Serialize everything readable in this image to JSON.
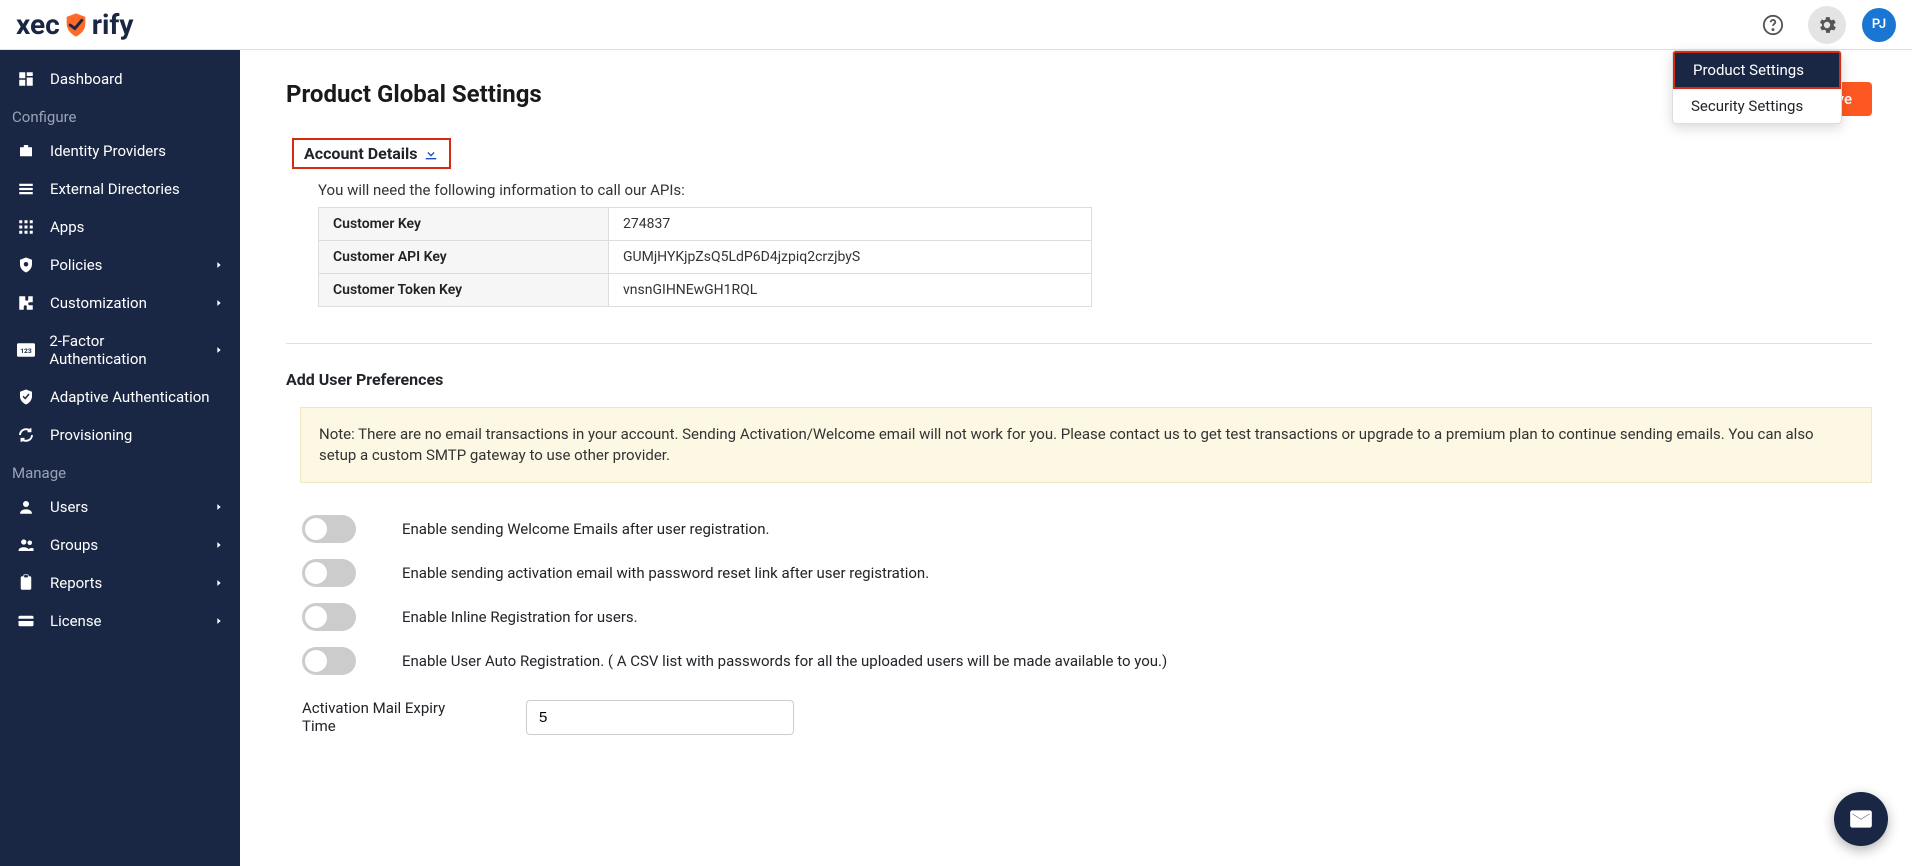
{
  "logo": {
    "prefix": "xec",
    "suffix": "rify"
  },
  "header": {
    "avatar_initials": "PJ"
  },
  "settings_menu": {
    "items": [
      {
        "label": "Product Settings",
        "active": true
      },
      {
        "label": "Security Settings",
        "active": false
      }
    ]
  },
  "sidebar": {
    "items": [
      {
        "label": "Dashboard",
        "icon": "dashboard"
      }
    ],
    "section_configure": "Configure",
    "configure_items": [
      {
        "label": "Identity Providers",
        "icon": "briefcase"
      },
      {
        "label": "External Directories",
        "icon": "list"
      },
      {
        "label": "Apps",
        "icon": "grid"
      },
      {
        "label": "Policies",
        "icon": "shield-search",
        "chevron": true
      },
      {
        "label": "Customization",
        "icon": "puzzle",
        "chevron": true
      },
      {
        "label": "2-Factor Authentication",
        "icon": "123",
        "chevron": true
      },
      {
        "label": "Adaptive Authentication",
        "icon": "shield-check"
      },
      {
        "label": "Provisioning",
        "icon": "sync"
      }
    ],
    "section_manage": "Manage",
    "manage_items": [
      {
        "label": "Users",
        "icon": "user",
        "chevron": true
      },
      {
        "label": "Groups",
        "icon": "users",
        "chevron": true
      },
      {
        "label": "Reports",
        "icon": "clipboard",
        "chevron": true
      },
      {
        "label": "License",
        "icon": "card",
        "chevron": true
      }
    ]
  },
  "page": {
    "title": "Product Global Settings",
    "save_label": "Save",
    "account_details_header": "Account Details",
    "api_info": "You will need the following information to call our APIs:",
    "details": [
      {
        "key": "Customer Key",
        "value": "274837"
      },
      {
        "key": "Customer API Key",
        "value": "GUMjHYKjpZsQ5LdP6D4jzpiq2crzjbyS"
      },
      {
        "key": "Customer Token Key",
        "value": "vnsnGIHNEwGH1RQL"
      }
    ],
    "prefs_title": "Add User Preferences",
    "note": "Note: There are no email transactions in your account. Sending Activation/Welcome email will not work for you. Please contact us to get test transactions or upgrade to a premium plan to continue sending emails. You can also setup a custom SMTP gateway to use other provider.",
    "toggles": [
      {
        "label": "Enable sending Welcome Emails after user registration."
      },
      {
        "label": "Enable sending activation email with password reset link after user registration."
      },
      {
        "label": "Enable Inline Registration for users."
      },
      {
        "label": "Enable User Auto Registration. ( A CSV list with passwords for all the uploaded users will be made available to you.)"
      }
    ],
    "expiry_label": "Activation Mail Expiry Time",
    "expiry_value": "5"
  }
}
